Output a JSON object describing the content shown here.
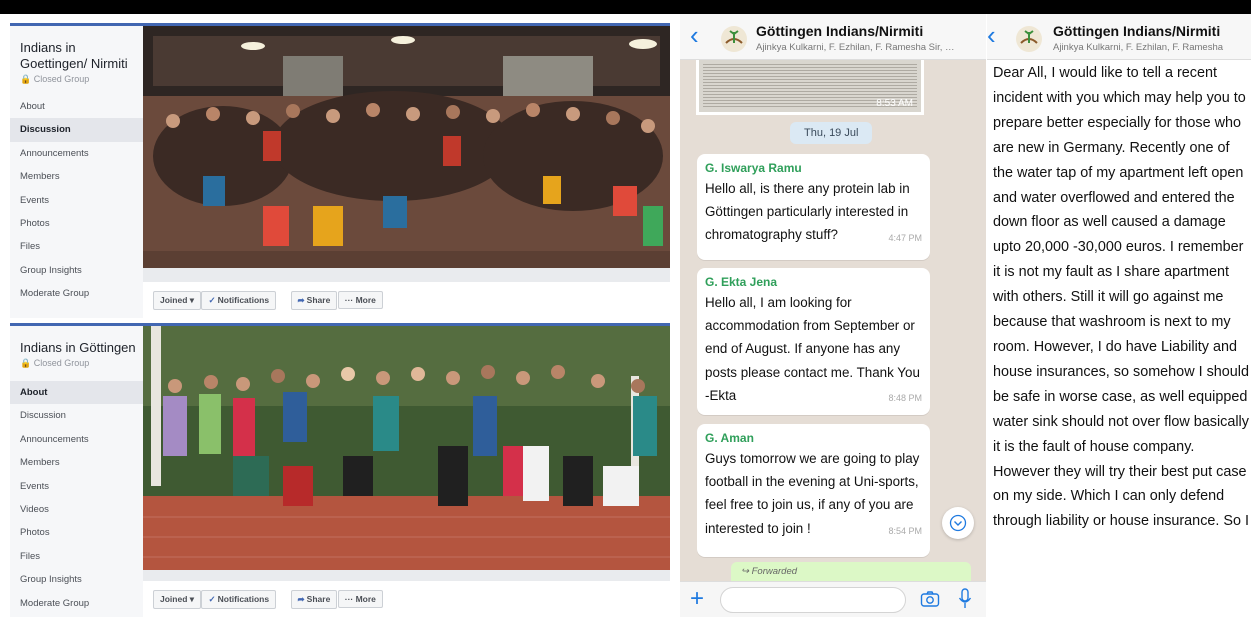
{
  "fb_group_1": {
    "name": "Indians in Goettingen/ Nirmiti",
    "privacy": "Closed Group",
    "menu": [
      "About",
      "Discussion",
      "Announcements",
      "Members",
      "Events",
      "Photos",
      "Files",
      "Group Insights",
      "Moderate Group"
    ],
    "active_index": 1,
    "actions": {
      "joined": "Joined ▾",
      "notifications": "Notifications",
      "share": "Share",
      "more": "··· More"
    }
  },
  "fb_group_2": {
    "name": "Indians in Göttingen",
    "privacy": "Closed Group",
    "menu": [
      "About",
      "Discussion",
      "Announcements",
      "Members",
      "Events",
      "Videos",
      "Photos",
      "Files",
      "Group Insights",
      "Moderate Group"
    ],
    "active_index": 0,
    "actions": {
      "joined": "Joined ▾",
      "notifications": "Notifications",
      "share": "Share",
      "more": "··· More"
    }
  },
  "whatsapp_1": {
    "title": "Göttingen Indians/Nirmiti",
    "participants": "Ajinkya Kulkarni, F. Ezhilan, F. Ramesha Sir, F...",
    "clipping_time": "8:53 AM",
    "date_chip": "Thu, 19 Jul",
    "messages": [
      {
        "sender": "G. Iswarya Ramu",
        "text": "Hello all, is there any protein  lab in Göttingen particularly interested in chromatography stuff?",
        "time": "4:47 PM"
      },
      {
        "sender": "G. Ekta Jena",
        "text": "Hello all, I am looking for accommodation from September or end of August. If anyone has any posts please contact me. Thank You -Ekta",
        "time": "8:48 PM"
      },
      {
        "sender": "G. Aman",
        "text": "Guys tomorrow we are going to play football in the evening at Uni-sports, feel free to join us, if any of you are interested to join !",
        "time": "8:54 PM"
      }
    ],
    "forwarded_label": "Forwarded"
  },
  "whatsapp_2": {
    "title": "Göttingen Indians/Nirmiti",
    "participants": "Ajinkya Kulkarni, F. Ezhilan, F. Ramesha",
    "message": "Dear All, I would like to tell a recent incident with you which may help you to prepare better especially for those who are new in Germany. Recently one of the water tap of my apartment left open and water overflowed and entered the down floor as well caused a damage upto 20,000 -30,000 euros. I remember it is not my fault as I share apartment with others. Still it will go against me because that washroom is next to my room. However, I do have Liability and house insurances, so somehow I should be safe in worse case, as well equipped water sink should not over flow basically it is the fault of house company. However they will try their best put case on my side. Which I can only defend through liability or house insurance. So I"
  },
  "colors": {
    "facebook_blue": "#4267b2",
    "whatsapp_blue": "#1f7ae0",
    "sender_green": "#2f9f5a",
    "chat_bg": "#e5ddd5"
  },
  "icons": [
    "back-chevron-icon",
    "group-avatar-icon",
    "scroll-down-icon",
    "plus-icon",
    "camera-icon",
    "microphone-icon",
    "check-icon",
    "share-arrow-icon"
  ]
}
